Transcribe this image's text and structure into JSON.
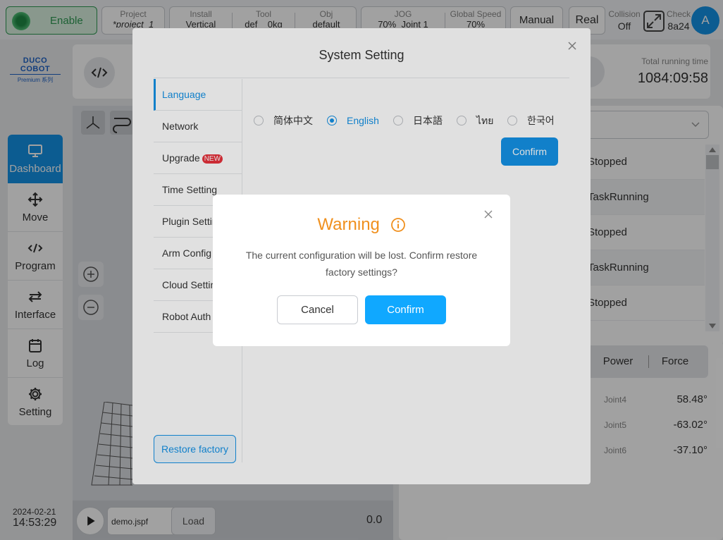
{
  "topbar": {
    "enable_label": "Enable",
    "project": {
      "label": "Project",
      "value": "*project_1"
    },
    "install": {
      "label": "Install",
      "value": "Vertical"
    },
    "tool": {
      "label": "Tool",
      "value": "def",
      "value2": "0kg"
    },
    "obj": {
      "label": "Obj",
      "value": "default"
    },
    "jog": {
      "label": "JOG",
      "value": "70%",
      "value2": "Joint 1"
    },
    "global_speed": {
      "label": "Global Speed",
      "value": "70%"
    },
    "mode": "Manual",
    "real": "Real",
    "collision": {
      "label": "Collision",
      "value": "Off"
    },
    "check": {
      "label": "Check",
      "value": "8a24"
    },
    "avatar": "A"
  },
  "logo": {
    "brand": "DUCO COBOT",
    "sub": "Premium 系列"
  },
  "nav": [
    {
      "label": "Dashboard",
      "icon": "monitor-icon"
    },
    {
      "label": "Move",
      "icon": "move-arrows-icon"
    },
    {
      "label": "Program",
      "icon": "code-icon"
    },
    {
      "label": "Interface",
      "icon": "swap-arrows-icon"
    },
    {
      "label": "Log",
      "icon": "calendar-icon"
    },
    {
      "label": "Setting",
      "icon": "gear-icon"
    }
  ],
  "datetime": {
    "date": "2024-02-21",
    "time": "14:53:29"
  },
  "runtime": {
    "label": "Total running time",
    "value": "1084:09:58"
  },
  "program": {
    "file": "demo.jspf",
    "load": "Load",
    "counter": "0.0"
  },
  "task_list": [
    "Stopped",
    "TaskRunning",
    "Stopped",
    "TaskRunning",
    "Stopped"
  ],
  "tabs": [
    "Power",
    "Force"
  ],
  "joints": [
    {
      "name": "Joint4",
      "value": "58.48°"
    },
    {
      "name": "Joint5",
      "value": "-63.02°"
    },
    {
      "name": "Joint6",
      "value": "-37.10°"
    }
  ],
  "system_setting": {
    "title": "System Setting",
    "menu": [
      "Language",
      "Network",
      "Upgrade",
      "Time Setting",
      "Plugin Setting",
      "Arm Config",
      "Cloud Setting",
      "Robot Auth"
    ],
    "new_badge": "NEW",
    "languages": [
      "简体中文",
      "English",
      "日本語",
      "ไทย",
      "한국어"
    ],
    "selected_language": "English",
    "confirm": "Confirm",
    "restore": "Restore factory"
  },
  "warning": {
    "title": "Warning",
    "message": "The current configuration will be lost. Confirm restore factory settings?",
    "cancel": "Cancel",
    "confirm": "Confirm"
  },
  "colors": {
    "accent": "#1492e6",
    "warning": "#f0901e",
    "enable_green": "#2e9a54"
  }
}
